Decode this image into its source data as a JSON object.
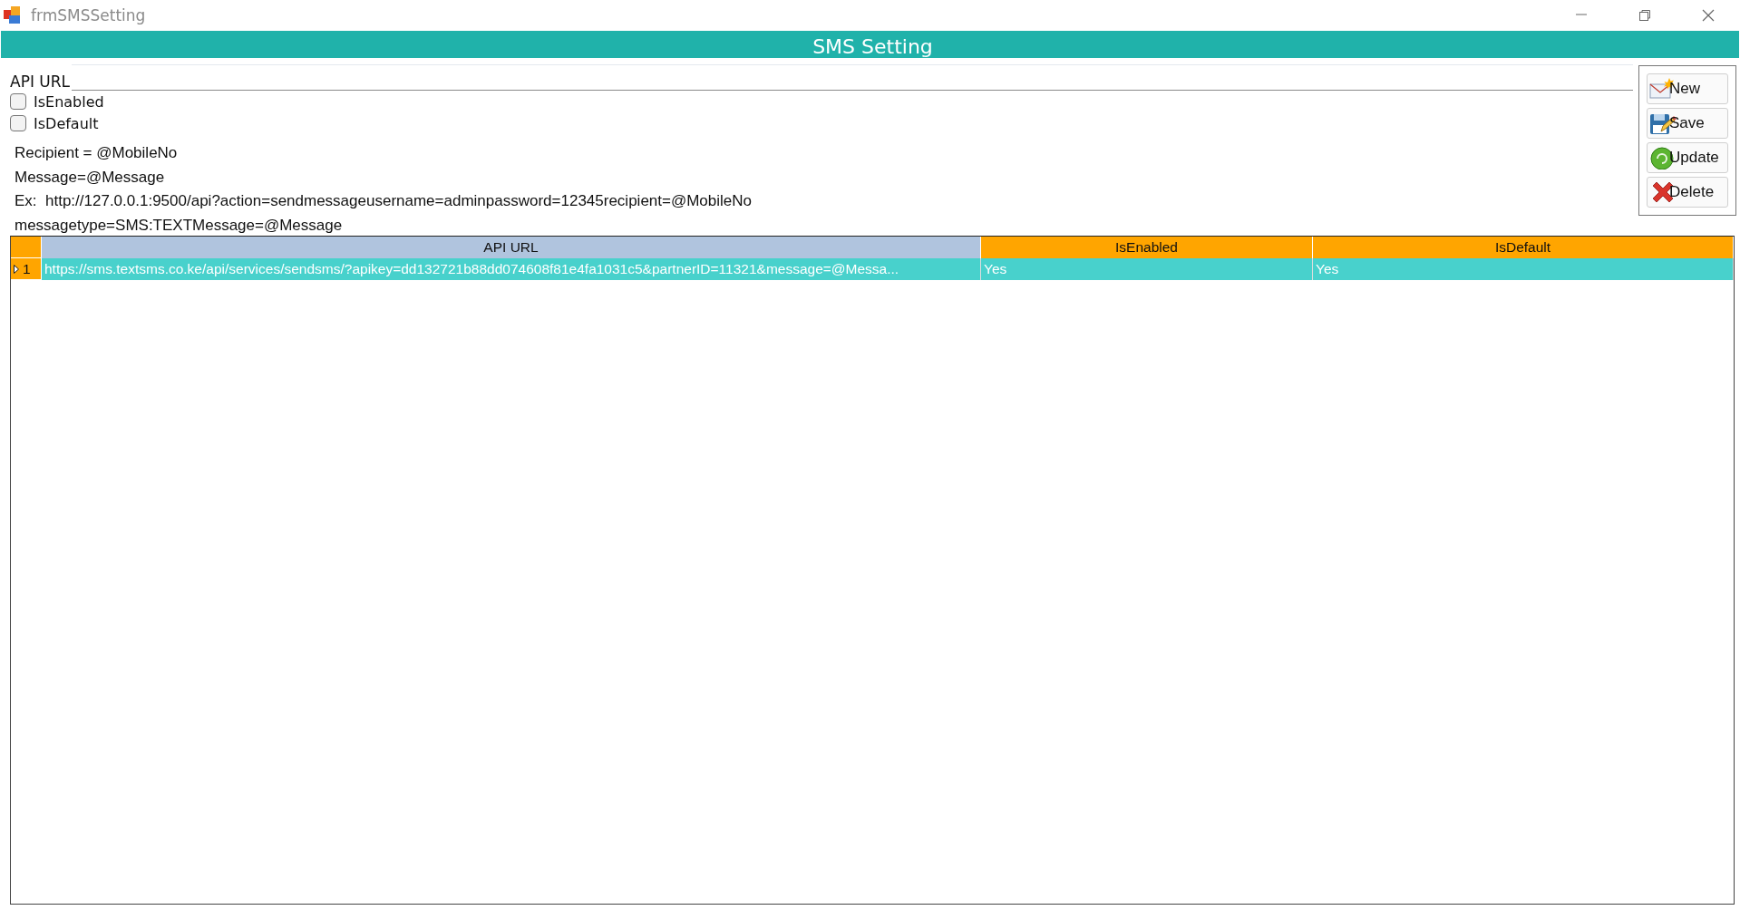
{
  "window": {
    "title": "frmSMSSetting"
  },
  "header": {
    "title": "SMS Setting"
  },
  "form": {
    "api_url_label": "API URL",
    "checkboxes": [
      {
        "label": "IsEnabled",
        "checked": false
      },
      {
        "label": "IsDefault",
        "checked": false
      }
    ],
    "notes": [
      "Recipient = @MobileNo",
      "Message=@Message",
      "Ex:  http://127.0.0.1:9500/api?action=sendmessageusername=adminpassword=12345recipient=@MobileNo",
      "messagetype=SMS:TEXTMessage=@Message"
    ]
  },
  "actions": [
    {
      "label": "New",
      "kind": "new"
    },
    {
      "label": "Save",
      "kind": "save"
    },
    {
      "label": "Update",
      "kind": "update"
    },
    {
      "label": "Delete",
      "kind": "delete"
    }
  ],
  "grid": {
    "columns": [
      {
        "label": "API URL",
        "selected": true
      },
      {
        "label": "IsEnabled",
        "selected": false
      },
      {
        "label": "IsDefault",
        "selected": false
      }
    ],
    "rows": [
      {
        "number": "1",
        "selected": true,
        "current": true,
        "cells": [
          "https://sms.textsms.co.ke/api/services/sendsms/?apikey=dd132721b88dd074608f81e4fa1031c5&partnerID=11321&message=@Messa...",
          "Yes",
          "Yes"
        ]
      }
    ]
  }
}
